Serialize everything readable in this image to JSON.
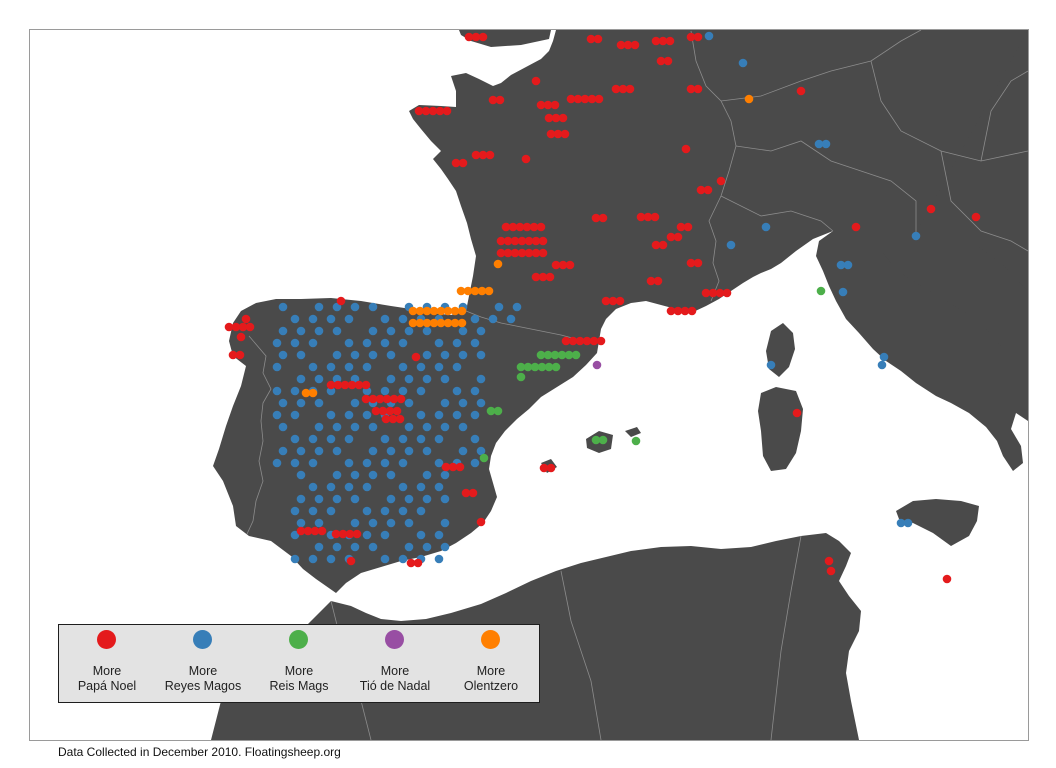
{
  "map": {
    "land_color": "#4a4a4a",
    "border_color": "#8c8c8c",
    "sea_color": "#ffffff"
  },
  "legend": {
    "items": [
      {
        "line1": "More",
        "line2": "Papá Noel",
        "color": "#e41a1c"
      },
      {
        "line1": "More",
        "line2": "Reyes Magos",
        "color": "#377eb8"
      },
      {
        "line1": "More",
        "line2": "Reis Mags",
        "color": "#4daf4a"
      },
      {
        "line1": "More",
        "line2": "Tió de Nadal",
        "color": "#984ea3"
      },
      {
        "line1": "More",
        "line2": "Olentzero",
        "color": "#ff7f00"
      }
    ]
  },
  "credit": "Data Collected in December 2010. Floatingsheep.org"
}
